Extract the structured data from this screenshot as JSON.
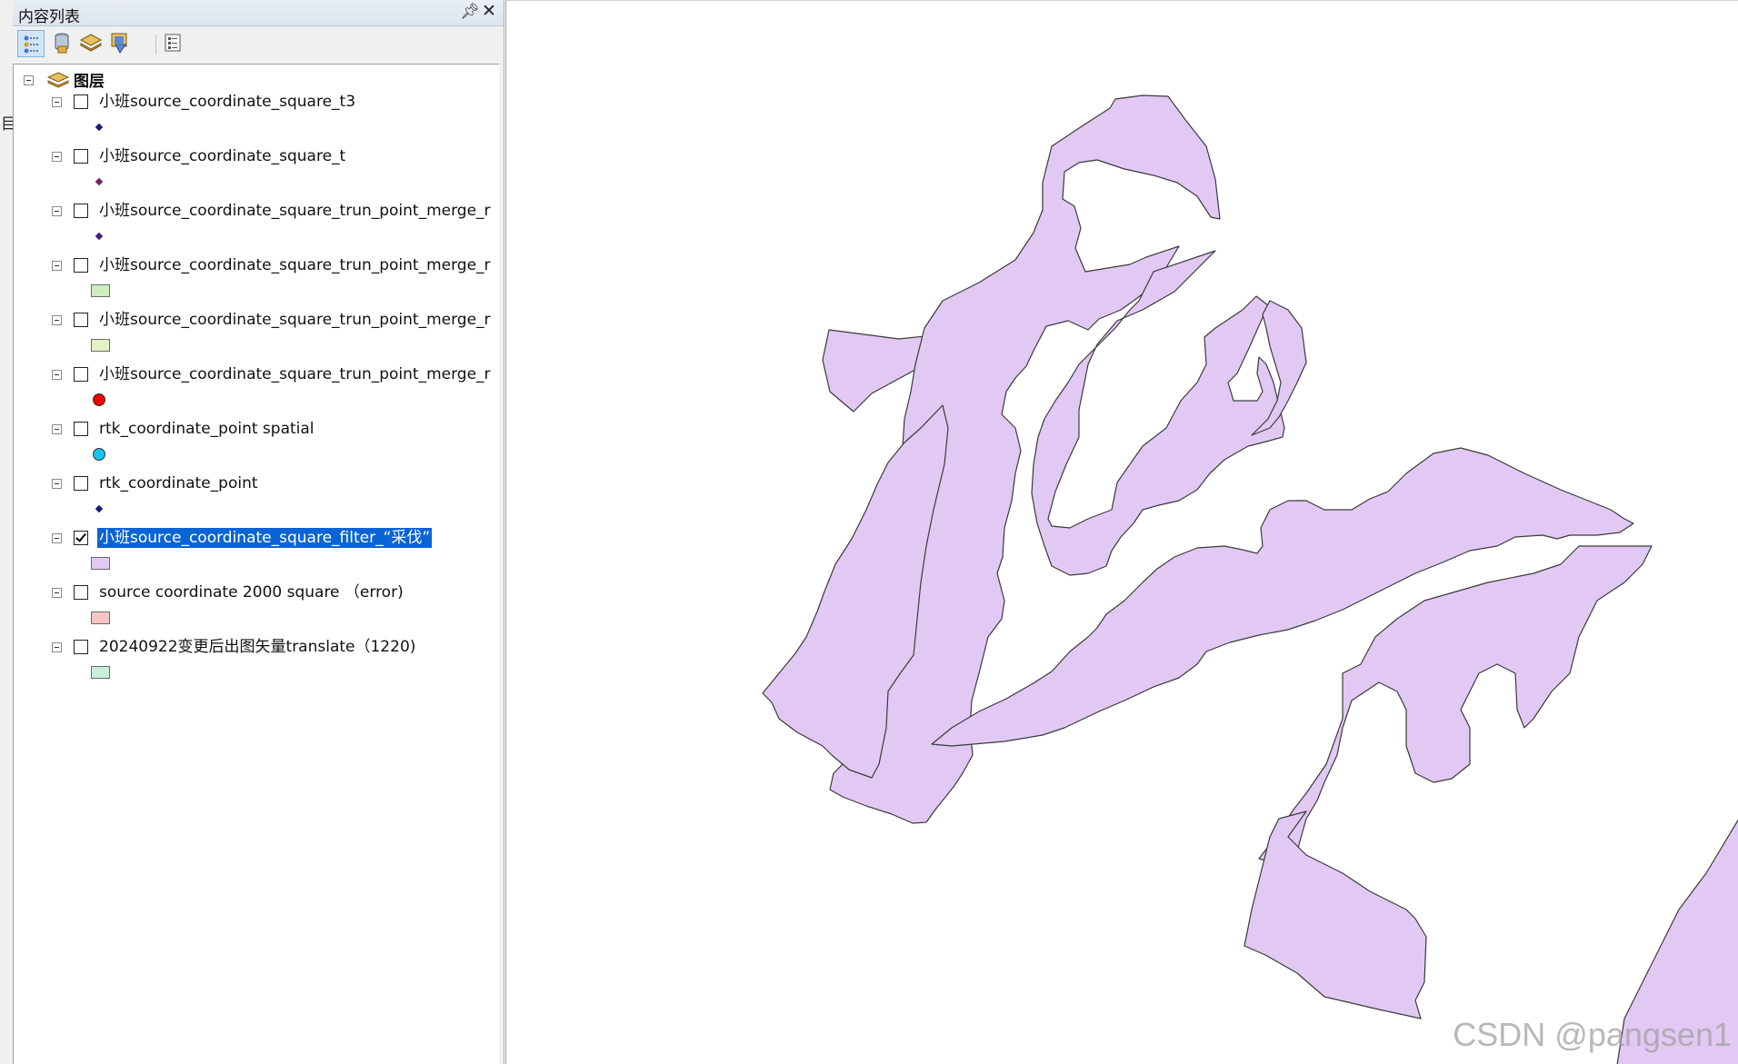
{
  "window": {
    "panel_title": "内容列表"
  },
  "toolbar": {
    "buttons": [
      {
        "icon": "list-by-drawing-order-icon",
        "active": true
      },
      {
        "icon": "list-by-source-icon",
        "active": false
      },
      {
        "icon": "list-by-visibility-icon",
        "active": false
      },
      {
        "icon": "list-by-selection-icon",
        "active": false
      },
      {
        "icon": "options-icon",
        "active": false
      }
    ]
  },
  "toc": {
    "group_label": "图层",
    "layers": [
      {
        "label": "小班source_coordinate_square_t3",
        "checked": false,
        "selected": false,
        "symbol": {
          "type": "diamond",
          "color": "#1a1a7a"
        }
      },
      {
        "label": "小班source_coordinate_square_t",
        "checked": false,
        "selected": false,
        "symbol": {
          "type": "diamond",
          "color": "#7a1a6a"
        }
      },
      {
        "label": "小班source_coordinate_square_trun_point_merge_r",
        "checked": false,
        "selected": false,
        "symbol": {
          "type": "diamond",
          "color": "#4a1a7a"
        }
      },
      {
        "label": "小班source_coordinate_square_trun_point_merge_r",
        "checked": false,
        "selected": false,
        "symbol": {
          "type": "rect",
          "color": "#cdeebc"
        }
      },
      {
        "label": "小班source_coordinate_square_trun_point_merge_r",
        "checked": false,
        "selected": false,
        "symbol": {
          "type": "rect",
          "color": "#e2f2c4"
        }
      },
      {
        "label": "小班source_coordinate_square_trun_point_merge_r",
        "checked": false,
        "selected": false,
        "symbol": {
          "type": "circle",
          "color": "#ee0000"
        }
      },
      {
        "label": "rtk_coordinate_point spatial",
        "checked": false,
        "selected": false,
        "symbol": {
          "type": "circle",
          "color": "#14c4f0"
        }
      },
      {
        "label": "rtk_coordinate_point",
        "checked": false,
        "selected": false,
        "symbol": {
          "type": "diamond",
          "color": "#1a1a7a"
        }
      },
      {
        "label": "小班source_coordinate_square_filter_“采伐”",
        "checked": true,
        "selected": true,
        "symbol": {
          "type": "rect",
          "color": "#e2c9f4"
        }
      },
      {
        "label": "source coordinate 2000 square （error)",
        "checked": false,
        "selected": false,
        "symbol": {
          "type": "rect",
          "color": "#f8c4c4"
        }
      },
      {
        "label": "20240922变更后出图矢量translate（1220)",
        "checked": false,
        "selected": false,
        "symbol": {
          "type": "rect",
          "color": "#c8f0d8"
        }
      }
    ]
  },
  "map": {
    "fill_color": "#e2c9f4",
    "outline_color": "#3a3a3a"
  },
  "watermark": "CSDN @pangsen1"
}
